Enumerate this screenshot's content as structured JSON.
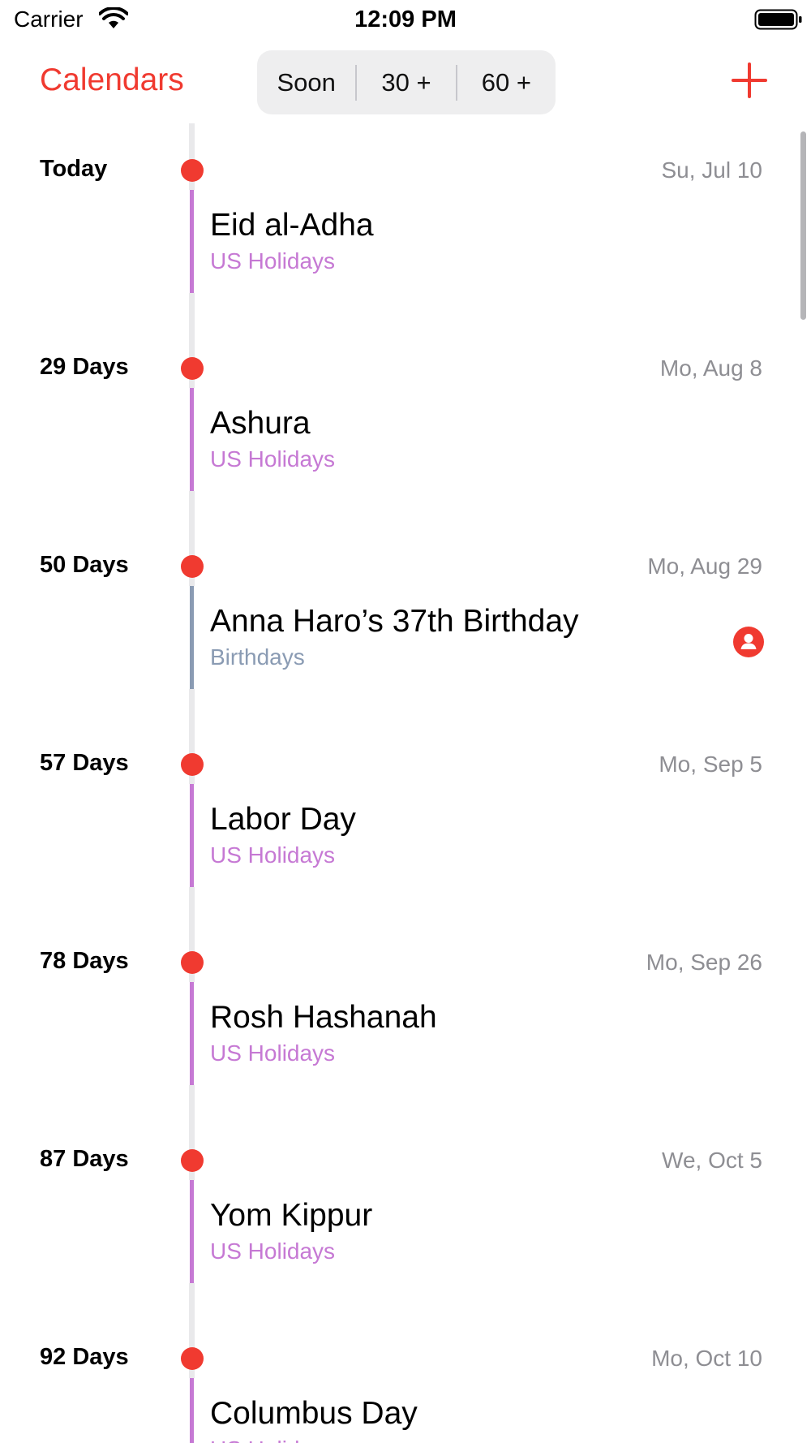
{
  "status_bar": {
    "carrier": "Carrier",
    "time": "12:09 PM"
  },
  "nav": {
    "back_label": "Calendars",
    "segments": [
      "Soon",
      "30 +",
      "60 +"
    ],
    "add_icon": "plus-icon"
  },
  "colors": {
    "accent": "#f03a30",
    "us_holidays": "#c679d4",
    "birthdays": "#8a9bb3",
    "muted": "#8e8e93"
  },
  "days": [
    {
      "count": "Today",
      "date": "Su, Jul 10",
      "event": {
        "title": "Eid al-Adha",
        "calendar": "US Holidays",
        "color": "#c679d4"
      }
    },
    {
      "count": "29 Days",
      "date": "Mo, Aug 8",
      "event": {
        "title": "Ashura",
        "calendar": "US Holidays",
        "color": "#c679d4"
      }
    },
    {
      "count": "50 Days",
      "date": "Mo, Aug 29",
      "event": {
        "title": "Anna Haro’s 37th Birthday",
        "calendar": "Birthdays",
        "color": "#8a9bb3",
        "icon": "contact-icon"
      }
    },
    {
      "count": "57 Days",
      "date": "Mo, Sep 5",
      "event": {
        "title": "Labor Day",
        "calendar": "US Holidays",
        "color": "#c679d4"
      }
    },
    {
      "count": "78 Days",
      "date": "Mo, Sep 26",
      "event": {
        "title": "Rosh Hashanah",
        "calendar": "US Holidays",
        "color": "#c679d4"
      }
    },
    {
      "count": "87 Days",
      "date": "We, Oct 5",
      "event": {
        "title": "Yom Kippur",
        "calendar": "US Holidays",
        "color": "#c679d4"
      }
    },
    {
      "count": "92 Days",
      "date": "Mo, Oct 10",
      "event": {
        "title": "Columbus Day",
        "calendar": "US Holidays",
        "color": "#c679d4"
      }
    }
  ]
}
